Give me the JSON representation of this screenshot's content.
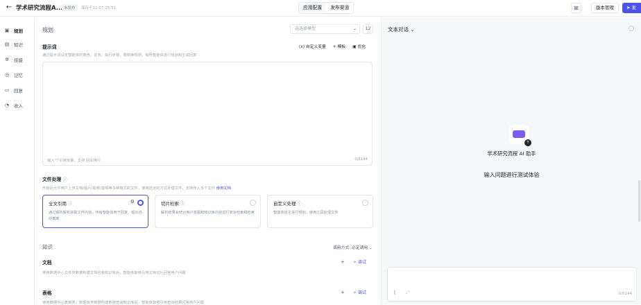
{
  "header": {
    "back_icon": "arrow-left-icon",
    "title": "学术研究流程A...",
    "status_badge": "未发布",
    "saved_text": "保存于11:07:25:51",
    "tabs": [
      {
        "label": "应用配置",
        "active": false
      },
      {
        "label": "发布渠道",
        "active": true
      }
    ],
    "grid_icon": "grid-icon",
    "version_label": "版本管理",
    "publish_label": "发"
  },
  "sidebar": {
    "items": [
      {
        "label": "规划",
        "icon": "plan-icon",
        "active": true
      },
      {
        "label": "知识",
        "icon": "book-icon",
        "active": false
      },
      {
        "label": "技能",
        "icon": "skill-icon",
        "active": false
      },
      {
        "label": "记忆",
        "icon": "memory-icon",
        "active": false
      },
      {
        "label": "回复",
        "icon": "reply-icon",
        "active": false
      },
      {
        "label": "收入",
        "icon": "income-icon",
        "active": false
      }
    ]
  },
  "main": {
    "heading": "规划",
    "model_select_placeholder": "选选择模型",
    "number_box": "12",
    "prompt": {
      "title": "提示词",
      "desc": "通过提示词设定智能体的角色、任务、执行步骤、限制等规则，指导智能体进行规划和生成回复",
      "actions": [
        "自定义变量",
        "模板",
        "优化"
      ],
      "placeholder": "输入\"/\"引用变量，支持 回车换行",
      "counter": "0/6144"
    },
    "file": {
      "title": "文件处理",
      "desc": "开启后允许用户上传文档/图片/视频/音频等多种格式的文件，使用选定的方式处理文件，支持传入多个文件",
      "link": "使用文档",
      "options": [
        {
          "title": "全文引用",
          "desc": "通过解析解析获取文件内容，传给智能体用于回复。超长自动截断",
          "selected": true
        },
        {
          "title": "切片检索",
          "desc": "解析结果会结合用户意图和知识库内容进行复杂检索和检索",
          "selected": false
        },
        {
          "title": "自定义处理",
          "desc": "智能体自主进行规划，使用工具处理文件",
          "selected": false
        }
      ]
    },
    "knowledge": {
      "title": "知识",
      "mode": "调用方式: 必定调用",
      "rows": [
        {
          "title": "文档",
          "desc": "使用数据中心文件类数据构建文档检索知识库后，智能体能够引用文档切片回答用户问题",
          "debug": "调试"
        },
        {
          "title": "表格",
          "desc": "使用数据中心表格类、数据库类数据构建数据查询知识库后，智能体能够引用查询结果回答用户问题",
          "debug": "调试"
        }
      ]
    }
  },
  "chat": {
    "title": "文本对话",
    "bot_name": "学术研究流程 AI 助手",
    "hint": "输入问题进行测试体验",
    "counter": "0/6144"
  }
}
